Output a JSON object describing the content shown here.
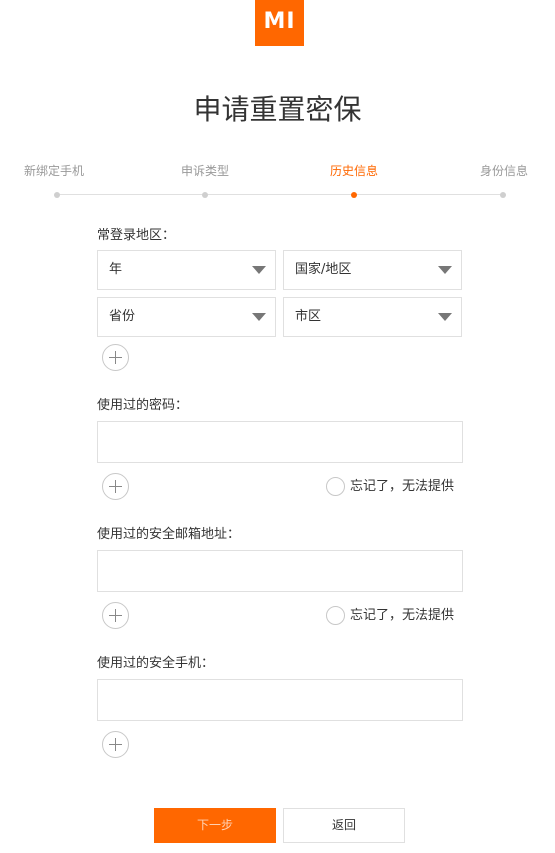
{
  "logo": {
    "text": "mi",
    "brand_color": "#ff6700"
  },
  "title": "申请重置密保",
  "steps": [
    {
      "label": "新绑定手机",
      "active": false
    },
    {
      "label": "申诉类型",
      "active": false
    },
    {
      "label": "历史信息",
      "active": true
    },
    {
      "label": "身份信息",
      "active": false
    }
  ],
  "region": {
    "label": "常登录地区：",
    "year_select": "年",
    "country_select": "国家/地区",
    "province_select": "省份",
    "city_select": "市区"
  },
  "password": {
    "label": "使用过的密码：",
    "value": "",
    "forgot_label": "忘记了，无法提供"
  },
  "email": {
    "label": "使用过的安全邮箱地址：",
    "value": "",
    "forgot_label": "忘记了，无法提供"
  },
  "phone": {
    "label": "使用过的安全手机：",
    "value": ""
  },
  "buttons": {
    "next": "下一步",
    "back": "返回"
  },
  "colors": {
    "accent": "#ff6700",
    "border": "#e0e0e0",
    "muted_text": "#999999"
  },
  "icons": {
    "add": "plus-circle-icon",
    "dropdown": "triangle-down-icon",
    "radio": "radio-circle-icon"
  }
}
